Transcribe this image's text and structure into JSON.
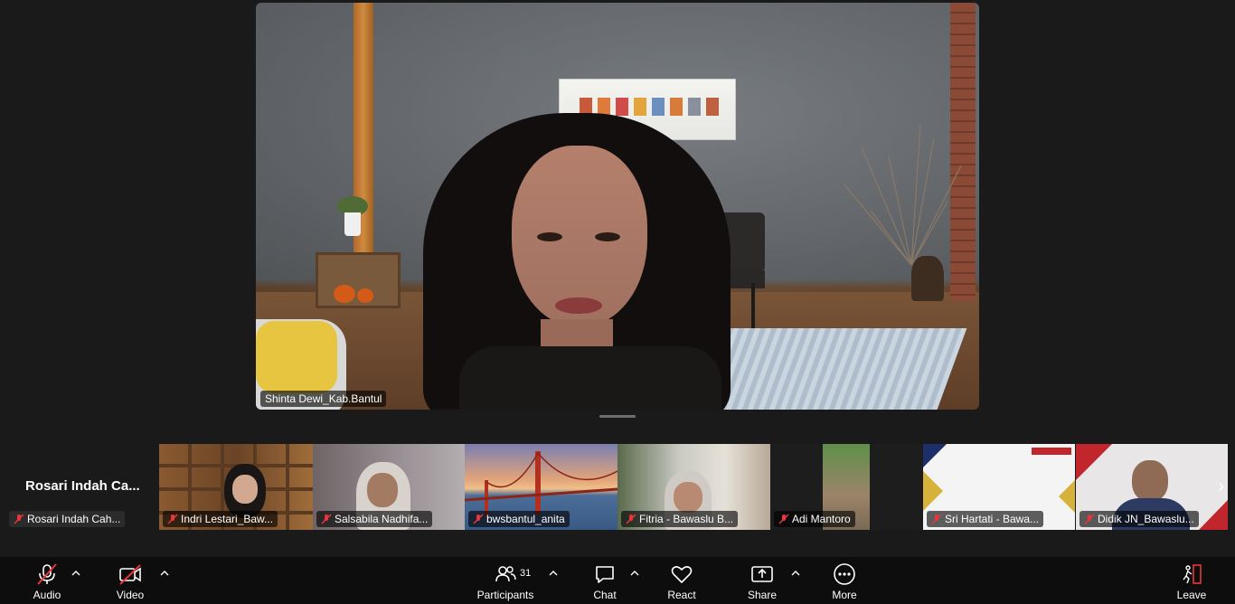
{
  "main_speaker": {
    "name": "Shinta Dewi_Kab.Bantul"
  },
  "self_view": {
    "heading": "Rosari Indah Ca...",
    "name": "Rosari Indah Cah..."
  },
  "gallery": [
    {
      "name": "Indri Lestari_Baw..."
    },
    {
      "name": "Salsabila Nadhifa..."
    },
    {
      "name": "bwsbantul_anita"
    },
    {
      "name": "Fitria - Bawaslu B..."
    },
    {
      "name": "Adi Mantoro"
    },
    {
      "name": "Sri Hartati - Bawa..."
    },
    {
      "name": "Didik JN_Bawaslu..."
    }
  ],
  "toolbar": {
    "audio": "Audio",
    "video": "Video",
    "participants": "Participants",
    "participants_count": "31",
    "chat": "Chat",
    "react": "React",
    "share": "Share",
    "more": "More",
    "leave": "Leave"
  },
  "colors": {
    "muted_red": "#e8363c",
    "leave_red": "#e8363c",
    "toolbar_bg": "#0d0d0d"
  }
}
